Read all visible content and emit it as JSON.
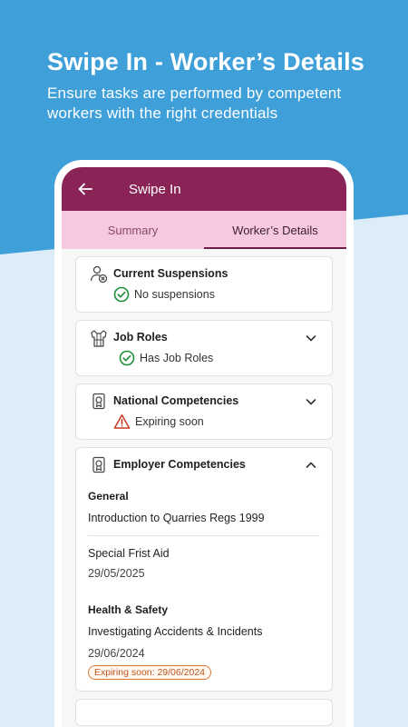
{
  "promo": {
    "title": "Swipe In - Worker’s Details",
    "subtitle": "Ensure tasks are performed by competent workers with the right credentials"
  },
  "appbar": {
    "title": "Swipe In",
    "back_icon": "arrow-left-icon"
  },
  "tabs": [
    {
      "label": "Summary",
      "active": false
    },
    {
      "label": "Worker’s Details",
      "active": true
    }
  ],
  "cards": {
    "suspensions": {
      "title": "Current Suspensions",
      "status": "No suspensions",
      "status_icon": "check-circle-icon"
    },
    "job_roles": {
      "title": "Job Roles",
      "status": "Has Job Roles",
      "status_icon": "check-circle-icon"
    },
    "national": {
      "title": "National Competencies",
      "status": "Expiring soon",
      "status_icon": "warning-icon"
    },
    "employer": {
      "title": "Employer Competencies",
      "groups": [
        {
          "label": "General",
          "items": [
            {
              "name": "Introduction to Quarries Regs 1999"
            },
            {
              "name": "Special Frist Aid",
              "date": "29/05/2025"
            }
          ]
        },
        {
          "label": "Health & Safety",
          "items": [
            {
              "name": "Investigating Accidents & Incidents",
              "date": "29/06/2024",
              "badge": "Expiring soon: 29/06/2024"
            }
          ]
        }
      ]
    }
  },
  "colors": {
    "background_blue": "#3f9fd9",
    "appbar": "#8a2456",
    "tabs_bg": "#f7c9e1",
    "ok_green": "#1f8f3a",
    "warn_red": "#c9381f"
  }
}
